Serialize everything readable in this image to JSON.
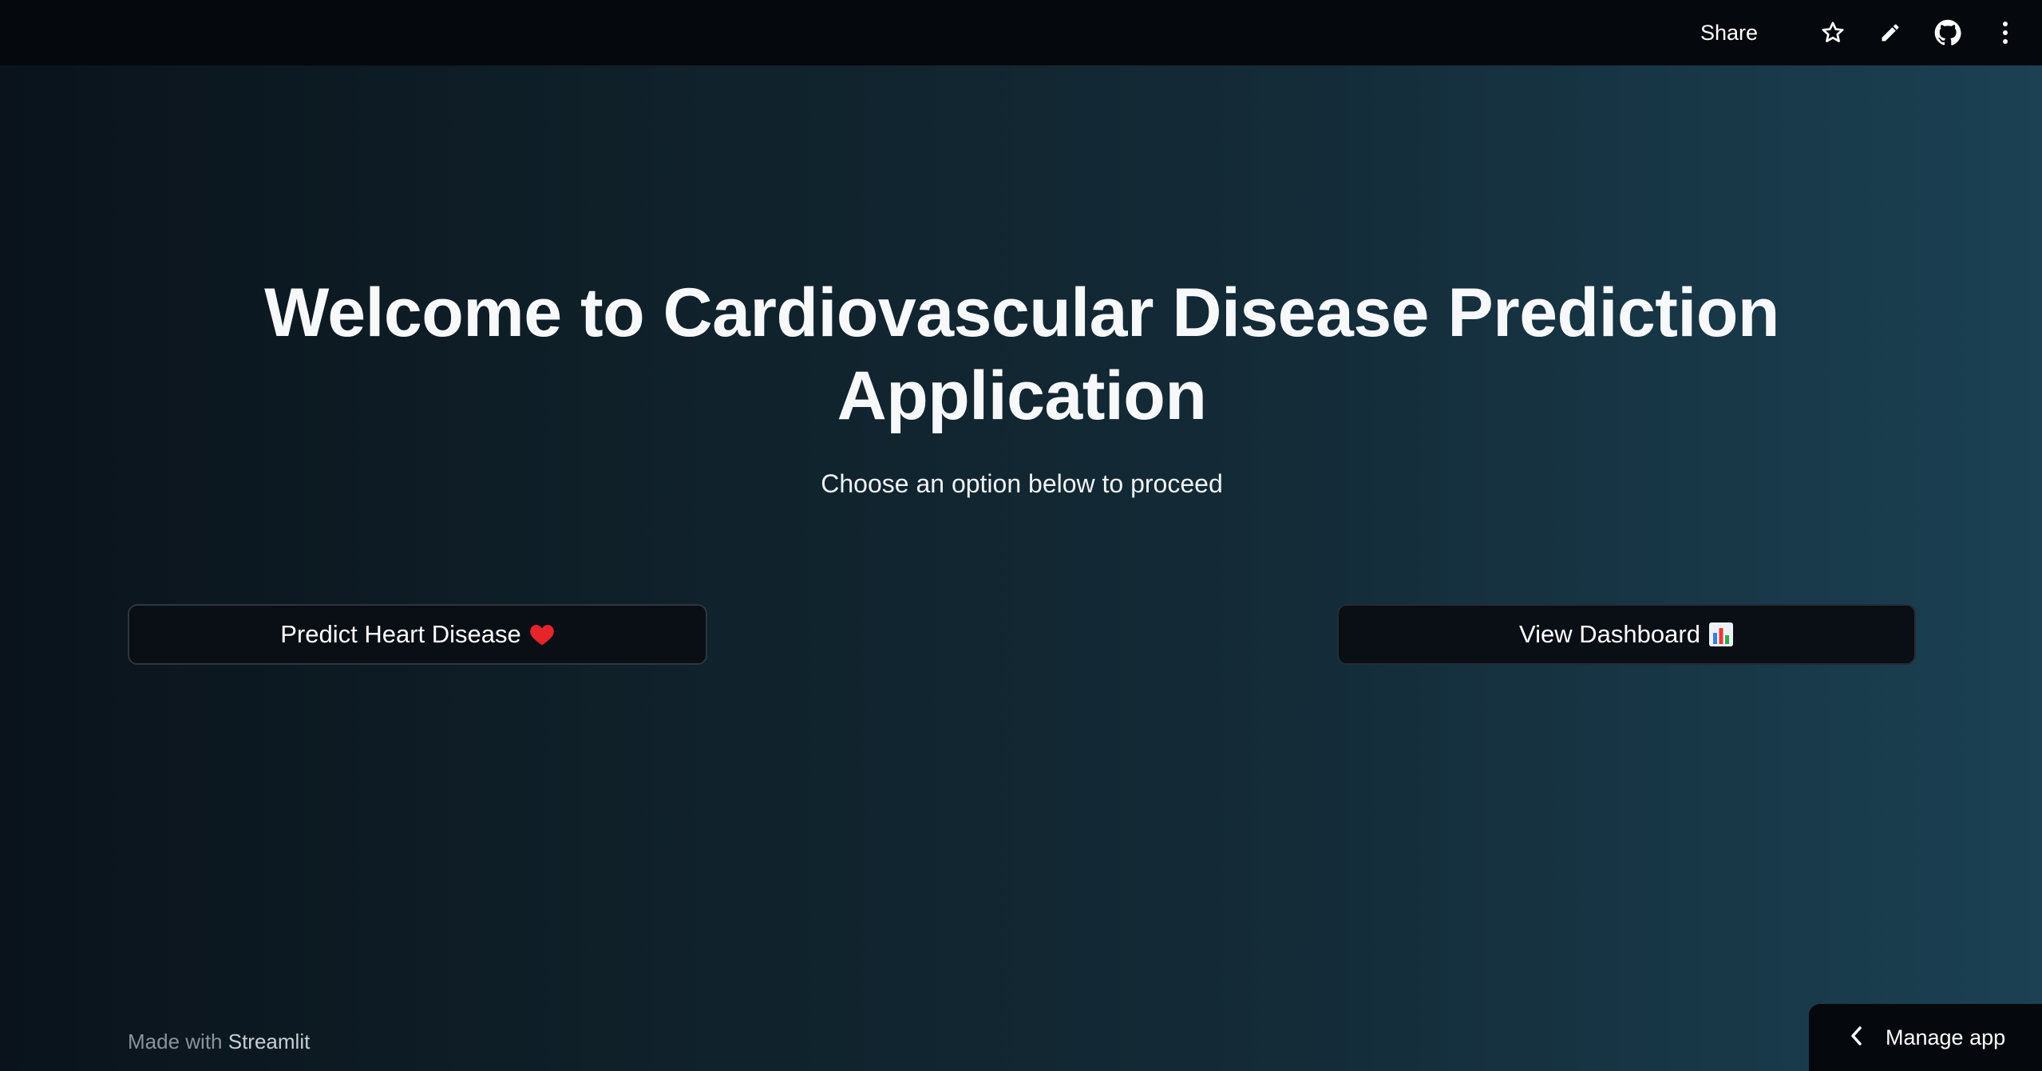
{
  "topbar": {
    "share_label": "Share",
    "icons": [
      "star-icon",
      "pencil-icon",
      "github-icon",
      "kebab-menu-icon"
    ]
  },
  "main": {
    "title": "Welcome to Cardiovascular Disease Prediction Application",
    "subtitle": "Choose an option below to proceed",
    "buttons": [
      {
        "label": "Predict Heart Disease",
        "icon": "red-heart-emoji"
      },
      {
        "label": "View Dashboard",
        "icon": "bar-chart-emoji"
      }
    ]
  },
  "footer": {
    "prefix": "Made with",
    "brand": "Streamlit"
  },
  "manage_app": {
    "label": "Manage app",
    "icon": "chevron-left-icon"
  },
  "colors": {
    "topbar_bg": "#05080d",
    "gradient_start": "#0a131b",
    "gradient_end": "#1b4153",
    "button_bg": "#0a0e15",
    "heart_red": "#e8242b"
  }
}
